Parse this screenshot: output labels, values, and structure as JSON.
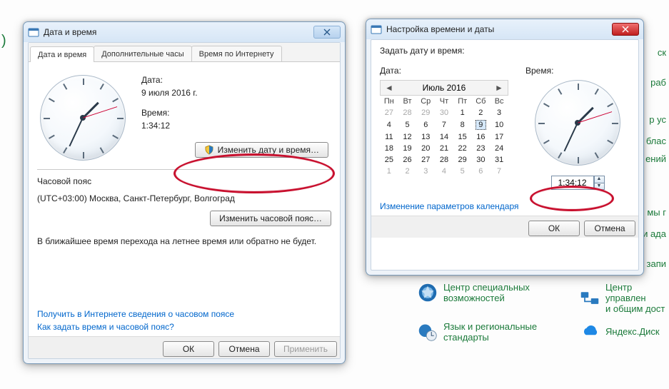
{
  "bg_items": {
    "center_top": "Центр специальных",
    "center_bot": "возможностей",
    "lang_top": "Язык и региональные",
    "lang_bot": "стандарты",
    "mgmt_top": "Центр управлен",
    "mgmt_bot": "и общим дост",
    "ydisk": "Яндекс.Диск",
    "r1": "ск",
    "r2": "раб",
    "r3": "р ус",
    "r4": "блас",
    "r5": "ений",
    "r6": "мы г",
    "r7": "и ада",
    "r8": "запи"
  },
  "dlg1": {
    "title": "Дата и время",
    "tabs": [
      "Дата и время",
      "Дополнительные часы",
      "Время по Интернету"
    ],
    "date_label": "Дата:",
    "date_value": "9 июля 2016 г.",
    "time_label": "Время:",
    "time_value": "1:34:12",
    "change_dt": "Изменить дату и время…",
    "tz_heading": "Часовой пояс",
    "tz_value": "(UTC+03:00) Москва, Санкт-Петербург, Волгоград",
    "change_tz": "Изменить часовой пояс…",
    "dst_text": "В ближайшее время перехода на летнее время или обратно не будет.",
    "link1": "Получить в Интернете сведения о часовом поясе",
    "link2": "Как задать время и часовой пояс?",
    "ok": "ОК",
    "cancel": "Отмена",
    "apply": "Применить"
  },
  "dlg2": {
    "title": "Настройка времени и даты",
    "heading": "Задать дату и время:",
    "date_label": "Дата:",
    "time_label": "Время:",
    "calendar": {
      "month_title": "Июль 2016",
      "dow": [
        "Пн",
        "Вт",
        "Ср",
        "Чт",
        "Пт",
        "Сб",
        "Вс"
      ],
      "leading_off": [
        27,
        28,
        29,
        30
      ],
      "days": [
        1,
        2,
        3,
        4,
        5,
        6,
        7,
        8,
        9,
        10,
        11,
        12,
        13,
        14,
        15,
        16,
        17,
        18,
        19,
        20,
        21,
        22,
        23,
        24,
        25,
        26,
        27,
        28,
        29,
        30,
        31
      ],
      "today": 9,
      "trailing_off": [
        1,
        2,
        3,
        4,
        5,
        6,
        7
      ]
    },
    "time_value": "1:34:12",
    "cal_link": "Изменение параметров календаря",
    "ok": "ОК",
    "cancel": "Отмена"
  },
  "clock": {
    "hour_deg": 45,
    "min_deg": 205,
    "sec_deg": 72
  }
}
